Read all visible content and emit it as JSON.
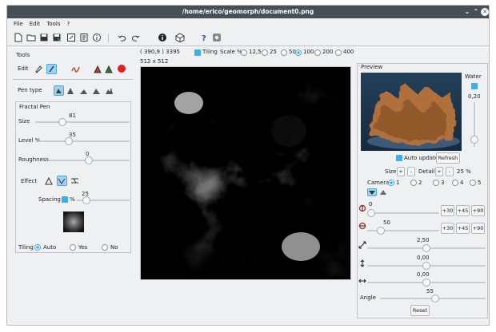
{
  "window": {
    "title": "/home/erico/geomorph/document0.png"
  },
  "menu": {
    "file": "File",
    "edit": "Edit",
    "tools": "Tools",
    "help": "?"
  },
  "toolbar": {
    "coords": "( 390,9 ) 3395",
    "tiling_label": "Tiling",
    "scale_label": "Scale %",
    "scale_options": [
      "12,5",
      "25",
      "50",
      "100",
      "200",
      "400"
    ],
    "scale_selected": "100",
    "image_size": "512 x 512"
  },
  "tools": {
    "title": "Tools",
    "edit_label": "Edit",
    "pen_type_label": "Pen type",
    "fractal_pen_title": "Fractal Pen",
    "size_label": "Size",
    "size_value": "81",
    "size_fraction": 0.27,
    "level_label": "Level %",
    "level_value": "35",
    "level_fraction": 0.32,
    "roughness_label": "Roughness",
    "roughness_value": "0",
    "roughness_fraction": 0.5,
    "effect_label": "Effect",
    "spacing_label": "Spacing",
    "spacing_pct": "%",
    "spacing_value": "25",
    "spacing_fraction": 0.12,
    "tiling_label": "Tiling",
    "tiling_options": [
      "Auto",
      "Yes",
      "No"
    ],
    "tiling_selected": "Auto"
  },
  "preview": {
    "title": "Preview",
    "water_label": "Water",
    "water_value": "0,20",
    "auto_update_label": "Auto update",
    "refresh_label": "Refresh",
    "size_label": "Size",
    "plus": "+",
    "minus": "-",
    "detail_label": "Detail",
    "detail_value": "25 %",
    "camera_label": "Camera",
    "camera_options": [
      "1",
      "2",
      "3",
      "4",
      "5"
    ],
    "camera_selected": "1",
    "rot_x_value": "0",
    "rot_z_value": "50",
    "btn_30": "+30",
    "btn_45": "+45",
    "btn_90": "+90",
    "scale_value": "2,50",
    "vshift_value": "0,00",
    "hshift_value": "0,00",
    "angle_label": "Angle",
    "angle_value": "55",
    "reset_label": "Reset"
  }
}
